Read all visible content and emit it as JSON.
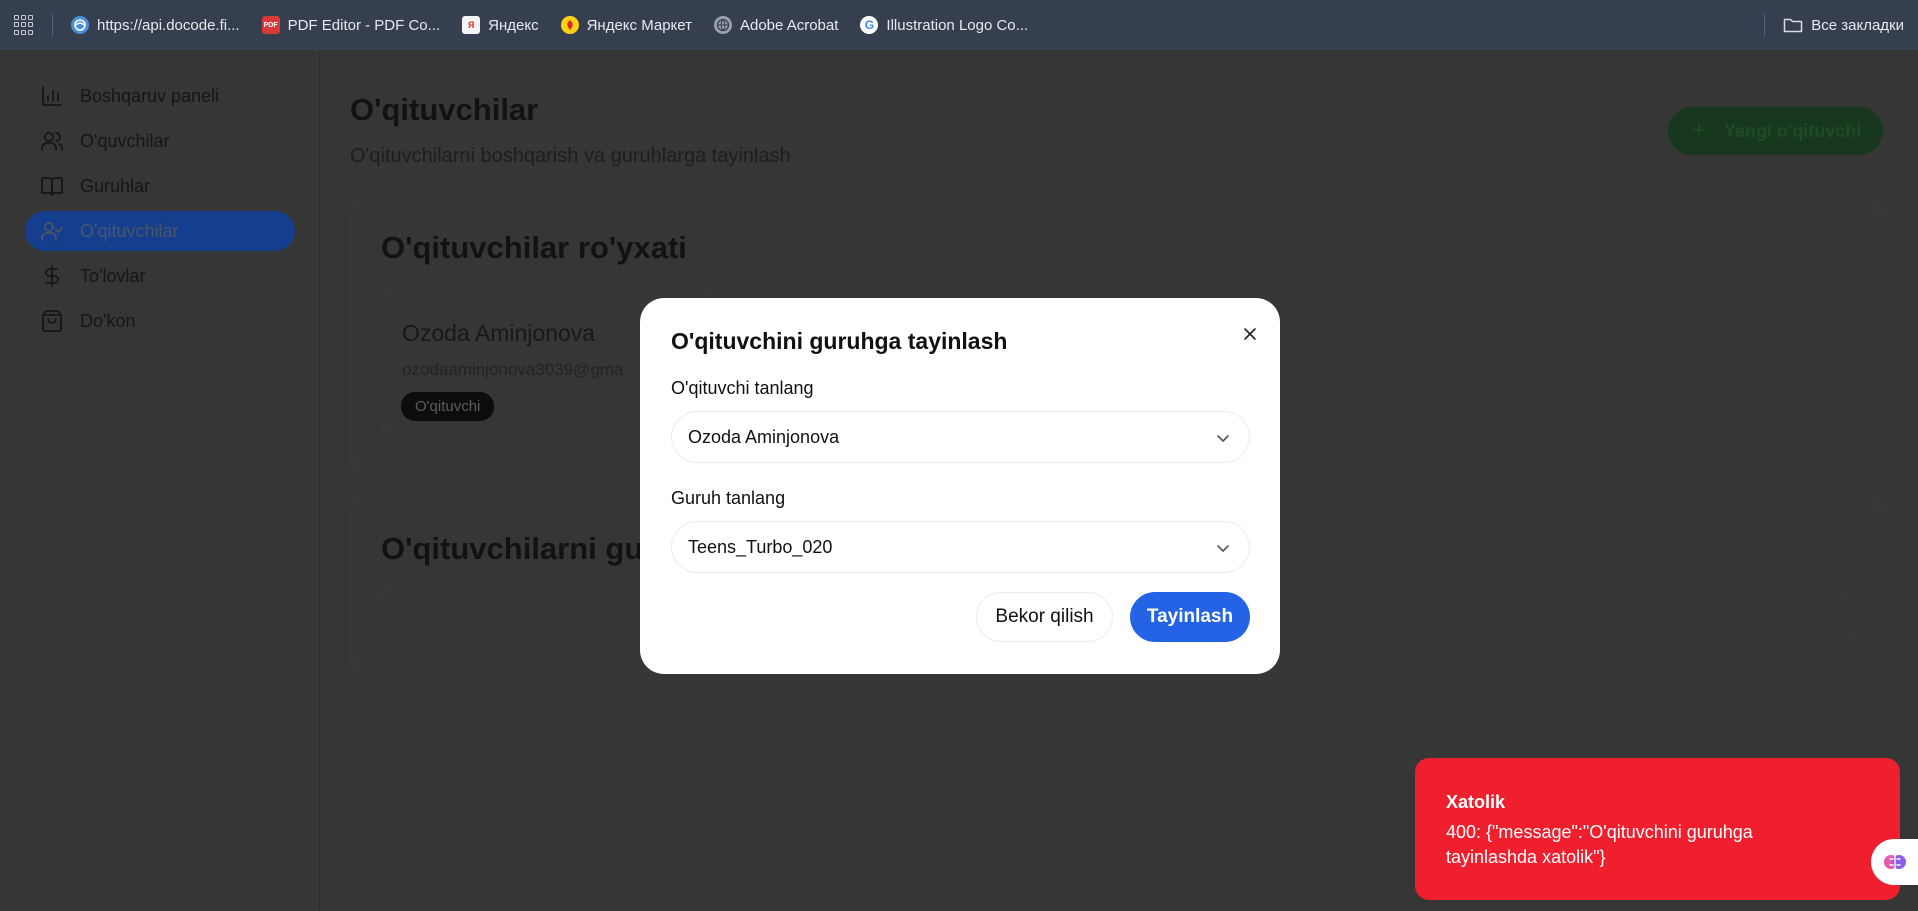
{
  "bookmarks": {
    "items": [
      {
        "label": "https://api.docode.fi...",
        "icon": "globe-swirl-icon",
        "color": "#4a90d9"
      },
      {
        "label": "PDF Editor - PDF Co...",
        "icon": "pdf-icon",
        "color": "#d83a3a",
        "badge": "PDF"
      },
      {
        "label": "Яндекс",
        "icon": "yandex-icon",
        "color": "#f5f5f5",
        "badge": "Я"
      },
      {
        "label": "Яндекс Маркет",
        "icon": "yandex-market-icon",
        "color": "#fcd316"
      },
      {
        "label": "Adobe Acrobat",
        "icon": "globe-icon",
        "color": "#9aa1ab"
      },
      {
        "label": "Illustration Logo Co...",
        "icon": "google-icon",
        "color": "#ffffff",
        "badge": "G"
      }
    ],
    "all_bookmarks": "Все закладки"
  },
  "sidebar": {
    "items": [
      {
        "label": "Boshqaruv paneli",
        "icon": "bar-chart-icon"
      },
      {
        "label": "O'quvchilar",
        "icon": "users-icon"
      },
      {
        "label": "Guruhlar",
        "icon": "book-icon"
      },
      {
        "label": "O'qituvchilar",
        "icon": "user-check-icon",
        "active": true
      },
      {
        "label": "To'lovlar",
        "icon": "dollar-icon"
      },
      {
        "label": "Do'kon",
        "icon": "shopping-bag-icon"
      }
    ]
  },
  "main": {
    "title": "O'qituvchilar",
    "subtitle": "O'qituvchilarni boshqarish va guruhlarga tayinlash",
    "new_button": "Yangi o'qituvchi",
    "list_title": "O'qituvchilar ro'yxati",
    "teacher": {
      "name": "Ozoda Aminjonova",
      "email": "ozodaaminjonova3039@gma",
      "role": "O'qituvchi"
    },
    "assign_section_title": "O'qituvchilarni guru"
  },
  "modal": {
    "title": "O'qituvchini guruhga tayinlash",
    "teacher_label": "O'qituvchi tanlang",
    "teacher_value": "Ozoda Aminjonova",
    "group_label": "Guruh tanlang",
    "group_value": "Teens_Turbo_020",
    "cancel": "Bekor qilish",
    "assign": "Tayinlash"
  },
  "toast": {
    "title": "Xatolik",
    "message": "400: {\"message\":\"O'qituvchini guruhga tayinlashda xatolik\"}"
  },
  "colors": {
    "primary": "#2563e6",
    "error": "#ef1f2d",
    "overlay": "#363636",
    "active_nav": "#163e8f"
  }
}
